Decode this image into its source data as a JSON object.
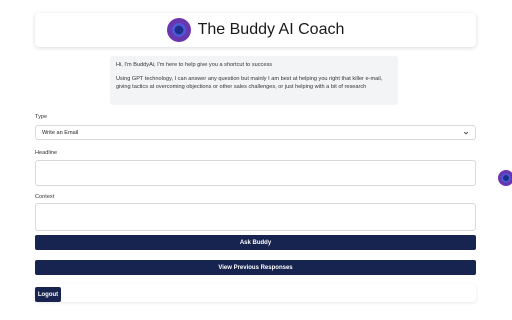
{
  "header": {
    "title": "The Buddy AI Coach",
    "logo_icon": "buddy-logo-icon"
  },
  "intro": {
    "line1": "Hi, I'm BuddyAi, I'm here to help give you a shortcut to success",
    "line2": "Using GPT technology, I can answer any question but mainly I am best at helping you right that killer e-mail, giving tactics at overcoming objections or other sales challenges, or just helping with a bit of research"
  },
  "form": {
    "type_label": "Type",
    "type_value": "Write an Email",
    "headline_label": "Headline",
    "context_label": "Context"
  },
  "buttons": {
    "ask": "Ask Buddy",
    "view_previous": "View Previous Responses",
    "logout": "Logout"
  },
  "colors": {
    "primary": "#17244f",
    "intro_bg": "#f3f4f6"
  }
}
